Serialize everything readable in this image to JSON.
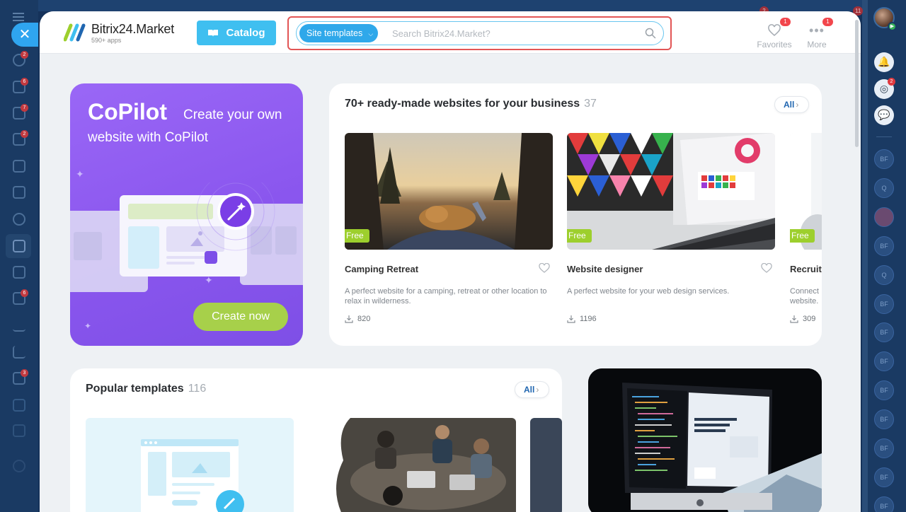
{
  "backdrop": {
    "left_badges": [
      "2",
      "6",
      "7",
      "2",
      "6",
      "3"
    ],
    "top_badges": [
      "2",
      "11"
    ],
    "right_badges": [
      "2"
    ],
    "user_initials": [
      "BF",
      "Q",
      "BF",
      "Q",
      "BF",
      "BF",
      "BF",
      "BF",
      "BF",
      "BF",
      "BF",
      "BF"
    ]
  },
  "header": {
    "logo_title": "Bitrix24.Market",
    "logo_subtitle": "590+ apps",
    "catalog_label": "Catalog",
    "search": {
      "tag_label": "Site templates",
      "placeholder": "Search Bitrix24.Market?"
    },
    "favorites": {
      "label": "Favorites",
      "badge": "1"
    },
    "more": {
      "label": "More",
      "badge": "1"
    }
  },
  "copilot": {
    "title": "CoPilot",
    "tagline_part1": "Create your own",
    "tagline_part2": "website with CoPilot",
    "button": "Create now"
  },
  "ready_made": {
    "title": "70+ ready-made websites for your business",
    "count": "37",
    "all_label": "All",
    "cards": [
      {
        "name": "Camping Retreat",
        "badge": "Free",
        "description": "A perfect website for a camping, retreat or other location to relax in wilderness.",
        "downloads": "820"
      },
      {
        "name": "Website designer",
        "badge": "Free",
        "description": "A perfect website for your web design services.",
        "downloads": "1196"
      },
      {
        "name": "Recruiti",
        "badge": "Free",
        "description": "Connect website.",
        "downloads": "309"
      }
    ]
  },
  "popular": {
    "title": "Popular templates",
    "count": "116",
    "all_label": "All"
  },
  "colors": {
    "accent": "#3fbff0",
    "search_tag": "#2fa8ea",
    "free_badge": "#9dcf2d",
    "copilot_bg": "#8a56ee",
    "create_btn": "#a7d04a",
    "highlight": "#e25555",
    "badge_red": "#f2464c"
  }
}
